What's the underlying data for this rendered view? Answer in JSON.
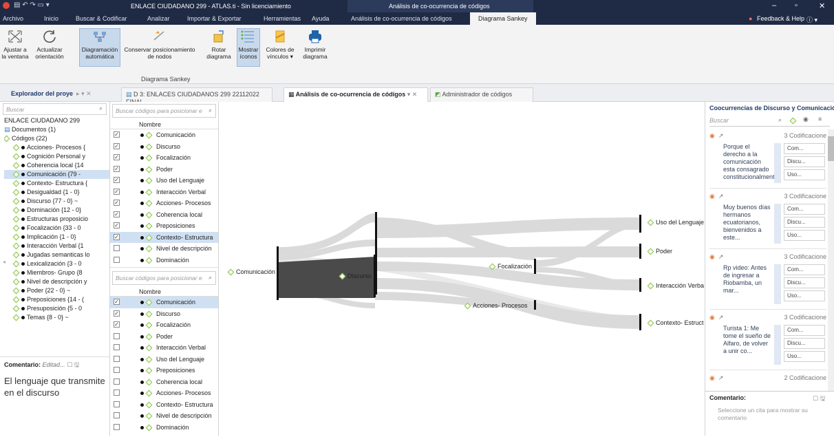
{
  "window": {
    "title": "ENLACE CIUDADANO 299 - ATLAS.ti - Sin licenciamiento",
    "context_title": "Análisis de co-ocurrencia de códigos"
  },
  "menu": {
    "items": [
      "Archivo",
      "Inicio",
      "Buscar & Codificar",
      "Analizar",
      "Importar & Exportar",
      "Herramientas",
      "Ayuda"
    ],
    "context_tabs": [
      "Análisis de co-ocurrencia de códigos",
      "Diagrama Sankey"
    ],
    "feedback": "Feedback & Help"
  },
  "ribbon": {
    "group_label": "Diagrama Sankey",
    "buttons": [
      {
        "l1": "Ajustar a",
        "l2": "la ventana"
      },
      {
        "l1": "Actualizar",
        "l2": "orientación"
      },
      {
        "l1": "Diagramación",
        "l2": "automática"
      },
      {
        "l1": "Conservar posicionamiento",
        "l2": "de nodos"
      },
      {
        "l1": "Rotar",
        "l2": "diagrama"
      },
      {
        "l1": "Mostrar",
        "l2": "íconos"
      },
      {
        "l1": "Colores de",
        "l2": "vínculos ▾"
      },
      {
        "l1": "Imprimir",
        "l2": "diagrama"
      }
    ]
  },
  "tabs": {
    "explorer": "Explorador del proye",
    "doc": "D 3: ENLACES CIUDADANOS 299 22112022 FINAL",
    "analysis": "Análisis de co-ocurrencia de códigos",
    "admin": "Administrador de códigos"
  },
  "explorer": {
    "search_placeholder": "Buscar",
    "project": "ENLACE CIUDADANO 299",
    "documents": "Documentos (1)",
    "codes": "Códigos (22)",
    "items": [
      "Acciones- Procesos {",
      "Cognición Personal y",
      "Coherencia local {14",
      "Comunicación {79 -",
      "Contexto- Estructura {",
      "Desigualdad {1 - 0}",
      "Discurso {77 - 0} ~",
      "Dominación {12 - 0}",
      "Estructuras proposicio",
      "Focalización {33 - 0",
      "Implicación {1 - 0}",
      "Interacción Verbal {1",
      "Jugadas semanticas lo",
      "Lexicalización {3 - 0",
      "Miembros- Grupo {8",
      "Nivel de descripción y",
      "Poder {22 - 0} ~",
      "Preposiciones {14 - (",
      "Presuposición {5 - 0",
      "Temas {8 - 0} ~"
    ],
    "comment_label": "Comentario:",
    "comment_status": "Editad...",
    "comment_text": "El lenguaje que transmite en el discurso"
  },
  "list_top": {
    "search_placeholder": "Buscar códigos para posicionar e",
    "header": "Nombre",
    "rows": [
      {
        "label": "Comunicación",
        "checked": true
      },
      {
        "label": "Discurso",
        "checked": true
      },
      {
        "label": "Focalización",
        "checked": true
      },
      {
        "label": "Poder",
        "checked": true
      },
      {
        "label": "Uso del Lenguaje",
        "checked": true
      },
      {
        "label": "Interacción Verbal",
        "checked": true
      },
      {
        "label": "Acciones- Procesos",
        "checked": true
      },
      {
        "label": "Coherencia local",
        "checked": true
      },
      {
        "label": "Preposiciones",
        "checked": true
      },
      {
        "label": "Contexto- Estructura",
        "checked": true
      },
      {
        "label": "Nivel de descripción",
        "checked": false
      },
      {
        "label": "Dominación",
        "checked": false
      }
    ]
  },
  "list_bottom": {
    "search_placeholder": "Buscar códigos para posicionar e",
    "header": "Nombre",
    "rows": [
      {
        "label": "Comunicación",
        "checked": true
      },
      {
        "label": "Discurso",
        "checked": true
      },
      {
        "label": "Focalización",
        "checked": true
      },
      {
        "label": "Poder",
        "checked": false
      },
      {
        "label": "Interacción Verbal",
        "checked": false
      },
      {
        "label": "Uso del Lenguaje",
        "checked": false
      },
      {
        "label": "Preposiciones",
        "checked": false
      },
      {
        "label": "Coherencia local",
        "checked": false
      },
      {
        "label": "Acciones- Procesos",
        "checked": false
      },
      {
        "label": "Contexto- Estructura",
        "checked": false
      },
      {
        "label": "Nivel de descripción",
        "checked": false
      },
      {
        "label": "Dominación",
        "checked": false
      }
    ]
  },
  "sankey": {
    "nodes": {
      "comunicacion": "Comunicación",
      "discurso": "Discurso",
      "focalizacion": "Focalización",
      "acciones": "Acciones- Procesos",
      "uso": "Uso del Lenguaje",
      "poder": "Poder",
      "interaccion": "Interacción Verba",
      "contexto": "Contexto- Estruct"
    }
  },
  "right": {
    "title": "Coocurrencias de Discurso y Comunicació",
    "search_placeholder": "Buscar",
    "cards": [
      {
        "count": "3 Codificacione",
        "quote": "Porque el derecho a la comunicación esta consagrado constitucionalment...",
        "tags": [
          "Com...",
          "Discu...",
          "Uso..."
        ]
      },
      {
        "count": "3 Codificacione",
        "quote": "Muy buenos días hermanos ecuatorianos, bienvenidos a este...",
        "tags": [
          "Com...",
          "Discu...",
          "Uso..."
        ]
      },
      {
        "count": "3 Codificacione",
        "quote": "Rp video: Antes de ingresar a Riobamba, un mar...",
        "tags": [
          "Com...",
          "Discu...",
          "Uso..."
        ]
      },
      {
        "count": "3 Codificacione",
        "quote": "Turista 1: Me tome el sueño de Alfaro, de volver a unir co...",
        "tags": [
          "Com...",
          "Discu...",
          "Uso..."
        ]
      },
      {
        "count": "2 Codificacione",
        "quote": "",
        "tags": []
      }
    ],
    "comment_label": "Comentario:",
    "comment_hint": "Seleccione un cita para mostrar su comentario"
  }
}
